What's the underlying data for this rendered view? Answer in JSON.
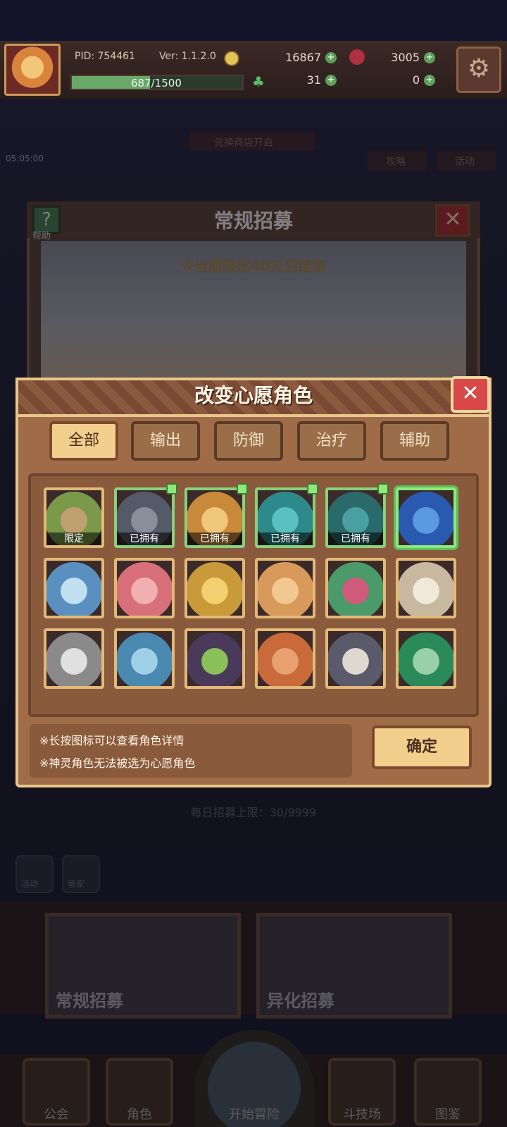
{
  "topbar": {
    "pid": "PID: 754461",
    "version": "Ver: 1.1.2.0",
    "currency_gold": "16867",
    "currency_gem": "3005",
    "exp": "687/1500",
    "exp_progress": 0.458,
    "clover_count": "31",
    "key_count": "0"
  },
  "background": {
    "timer": "05:05:00",
    "shop_banner": "兑换商店开启",
    "guide_label": "攻略",
    "event_label": "活动",
    "recruit_title": "常规招募",
    "help_label": "帮助",
    "recruit_note": "※当期限定40天后结束",
    "daily_limit": "每日招募上限：30/9999",
    "side_left_label": "活动",
    "side_right_label": "管家",
    "banner_normal": "常规招募",
    "banner_alien": "异化招募",
    "nav": [
      "公会",
      "角色",
      "开始冒险",
      "斗技场",
      "图鉴"
    ]
  },
  "dialog": {
    "title": "改变心愿角色",
    "tabs": [
      "全部",
      "输出",
      "防御",
      "治疗",
      "辅助"
    ],
    "active_tab": 0,
    "characters": [
      {
        "tag": "限定",
        "status": "limited",
        "colors": [
          "#7a9a4a",
          "#c0a070"
        ]
      },
      {
        "tag": "已拥有",
        "status": "owned",
        "colors": [
          "#545a68",
          "#8a8e9a"
        ]
      },
      {
        "tag": "已拥有",
        "status": "owned",
        "colors": [
          "#c88a3a",
          "#f0c77a"
        ]
      },
      {
        "tag": "已拥有",
        "status": "owned",
        "colors": [
          "#2e8a8a",
          "#5ac0c0"
        ]
      },
      {
        "tag": "已拥有",
        "status": "owned",
        "colors": [
          "#2a6a6a",
          "#4aa0a0"
        ]
      },
      {
        "tag": "",
        "status": "selected",
        "colors": [
          "#2a5ab0",
          "#5a9ae0"
        ]
      },
      {
        "tag": "",
        "status": "none",
        "colors": [
          "#5a90c0",
          "#c0e0f0"
        ]
      },
      {
        "tag": "",
        "status": "none",
        "colors": [
          "#d8707a",
          "#f0b0b0"
        ]
      },
      {
        "tag": "",
        "status": "none",
        "colors": [
          "#c89a3a",
          "#f0d070"
        ]
      },
      {
        "tag": "",
        "status": "none",
        "colors": [
          "#d89a5a",
          "#f0c890"
        ]
      },
      {
        "tag": "",
        "status": "none",
        "colors": [
          "#4a9a6a",
          "#d05a7a"
        ]
      },
      {
        "tag": "",
        "status": "none",
        "colors": [
          "#c8b8a0",
          "#f0e8d8"
        ]
      },
      {
        "tag": "",
        "status": "none",
        "colors": [
          "#8a8a8a",
          "#e0e0e0"
        ]
      },
      {
        "tag": "",
        "status": "none",
        "colors": [
          "#4a8ab0",
          "#a0d0e8"
        ]
      },
      {
        "tag": "",
        "status": "none",
        "colors": [
          "#4a3a5a",
          "#8ac05a"
        ]
      },
      {
        "tag": "",
        "status": "none",
        "colors": [
          "#c86a3a",
          "#e8a070"
        ]
      },
      {
        "tag": "",
        "status": "none",
        "colors": [
          "#5a5a6a",
          "#e0d8d0"
        ]
      },
      {
        "tag": "",
        "status": "none",
        "colors": [
          "#2a8a5a",
          "#9ad0a8"
        ]
      }
    ],
    "notes": [
      "※长按图标可以查看角色详情",
      "※神灵角色无法被选为心愿角色"
    ],
    "confirm_label": "确定"
  },
  "colors": {
    "accent": "#f3cf8e",
    "owned": "#89d17c",
    "close": "#d84848"
  }
}
